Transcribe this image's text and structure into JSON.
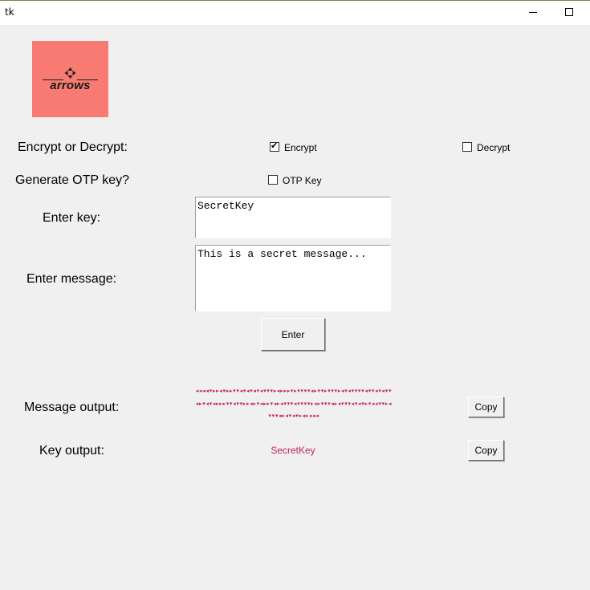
{
  "window": {
    "title": "tk"
  },
  "logo": {
    "text": "arrows"
  },
  "mode": {
    "label": "Encrypt or Decrypt:",
    "encrypt_label": "Encrypt",
    "encrypt_checked": true,
    "decrypt_label": "Decrypt",
    "decrypt_checked": false
  },
  "otp": {
    "label": "Generate OTP key?",
    "checkbox_label": "OTP Key",
    "checked": false
  },
  "key": {
    "label": "Enter key:",
    "value": "SecretKey"
  },
  "message": {
    "label": "Enter message:",
    "value": "This is a secret message..."
  },
  "enter_button": "Enter",
  "output": {
    "message_label": "Message output:",
    "message_value": "◂◂◂◂▾▸▸◂▾▸▸▾▾◂▾◂▾◂▾◂▾▾▾▸◂▸▸▸▾▸▾▾▾▾◂▸▾▾▸▾▾▾▸◂▾◂▾▾▾▾◂▾▾◂▾◂▾▾◂▸▾◂▾◂▸▸▸▾▾◂▾▾▸▸◂▸▾◂▸▸▾◂▸◂▾▾▾◂▾▾▾▾▸◂▸▾▾▾◂▸◂▾▾▾◂▾◂▾▸▾◂◂▾▾▸◂▾▾▾◂▸◂▾◂▾▸◂▸◂◂◂",
    "message_copy": "Copy",
    "key_label": "Key output:",
    "key_value": "SecretKey",
    "key_copy": "Copy"
  },
  "colors": {
    "output_text": "#c0245a",
    "logo_bg": "#f77b72",
    "window_bg": "#f0f0f0"
  },
  "icons": {
    "minimize": "minimize-icon",
    "maximize": "maximize-icon",
    "check": "check-icon"
  }
}
